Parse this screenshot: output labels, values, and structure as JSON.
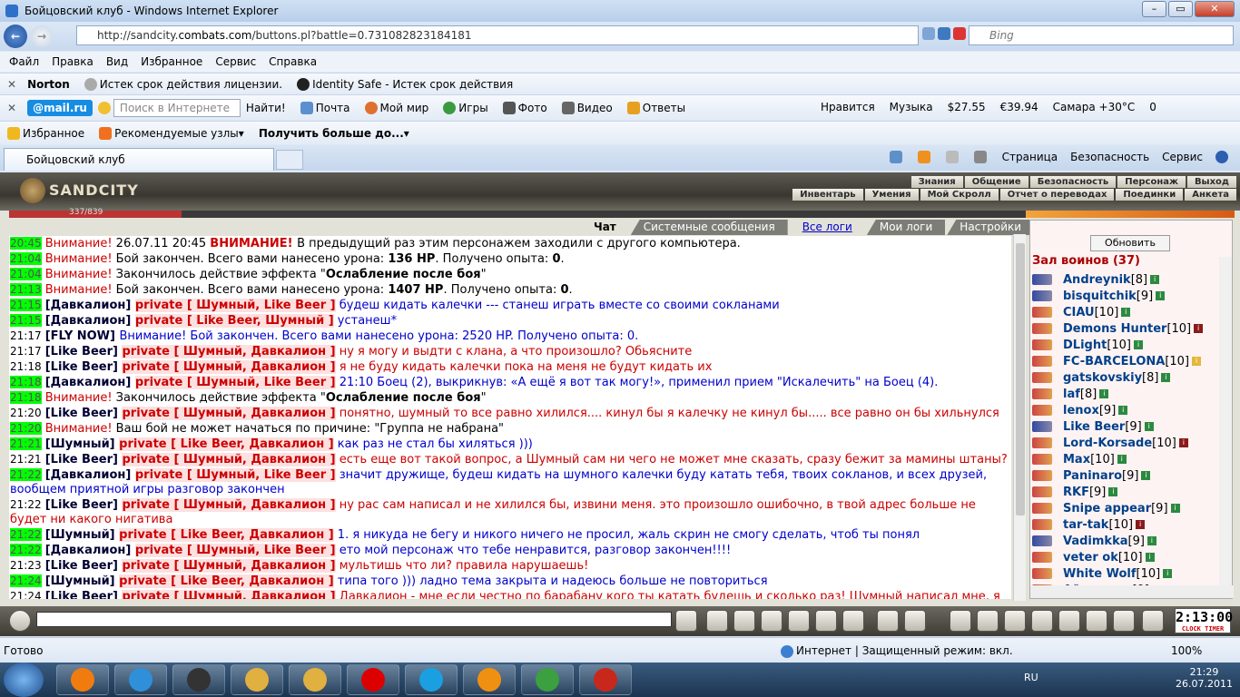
{
  "window": {
    "title": "Бойцовский клуб - Windows Internet Explorer",
    "url_prefix": "http://sandcity.",
    "url_host": "combats.com",
    "url_rest": "/buttons.pl?battle=0.731082823184181",
    "search_placeholder": "Bing"
  },
  "menu": [
    "Файл",
    "Правка",
    "Вид",
    "Избранное",
    "Сервис",
    "Справка"
  ],
  "norton": {
    "logo": "Norton",
    "items": [
      "Истек срок действия лицензии.",
      "Identity Safe - Истек срок действия"
    ]
  },
  "mailru": {
    "logo": "@mail.ru",
    "search_placeholder": "Поиск в Интернете",
    "find": "Найти!",
    "links": [
      "Почта",
      "Мой мир",
      "Игры",
      "Фото",
      "Видео",
      "Ответы"
    ],
    "right": [
      "Нравится",
      "Музыка",
      "$27.55",
      "€39.94",
      "Самара +30°C",
      "0"
    ]
  },
  "favorites": {
    "label": "Избранное",
    "items": [
      "Рекомендуемые узлы",
      "Получить больше до..."
    ]
  },
  "tab": {
    "title": "Бойцовский клуб"
  },
  "commandbar": [
    "Страница",
    "Безопасность",
    "Сервис"
  ],
  "game": {
    "logo": "SANDCITY",
    "menu1": [
      "Знания",
      "Общение",
      "Безопасность",
      "Персонаж",
      "Выход"
    ],
    "menu2": [
      "Инвентарь",
      "Умения",
      "Мой Скролл",
      "Отчет о переводах",
      "Поединки",
      "Анкета"
    ],
    "hp_label": "337/839",
    "chat_tabs": [
      "Чат",
      "Системные сообщения",
      "Все логи",
      "Мои логи",
      "Настройки"
    ],
    "chat": [
      {
        "t": "20:45",
        "hl": true,
        "parts": [
          [
            "red",
            "Внимание! "
          ],
          [
            "",
            "26.07.11 20:45 "
          ],
          [
            "redb",
            "ВНИМАНИЕ! "
          ],
          [
            "",
            "В предыдущий раз этим персонажем заходили с другого компьютера."
          ]
        ]
      },
      {
        "t": "21:04",
        "hl": true,
        "parts": [
          [
            "red",
            "Внимание! "
          ],
          [
            "",
            "Бой закончен. Всего вами нанесено урона: "
          ],
          [
            "b",
            "136 HP"
          ],
          [
            "",
            ". Получено опыта: "
          ],
          [
            "b",
            "0"
          ],
          [
            "",
            "."
          ]
        ]
      },
      {
        "t": "21:04",
        "hl": true,
        "parts": [
          [
            "red",
            "Внимание! "
          ],
          [
            "",
            "Закончилось действие эффекта \""
          ],
          [
            "b",
            "Ослабление после боя"
          ],
          [
            "",
            "\""
          ]
        ]
      },
      {
        "t": "21:13",
        "hl": true,
        "parts": [
          [
            "red",
            "Внимание! "
          ],
          [
            "",
            "Бой закончен. Всего вами нанесено урона: "
          ],
          [
            "b",
            "1407 HP"
          ],
          [
            "",
            ". Получено опыта: "
          ],
          [
            "b",
            "0"
          ],
          [
            "",
            "."
          ]
        ]
      },
      {
        "t": "21:15",
        "hl": true,
        "parts": [
          [
            "nick",
            "[Давкалион] "
          ],
          [
            "privb",
            "private [ Шумный, Like Beer ]"
          ],
          [
            "blue",
            " будеш кидать калечки --- станеш играть вместе со своими сокланами"
          ]
        ]
      },
      {
        "t": "21:15",
        "hl": true,
        "parts": [
          [
            "nick",
            "[Давкалион] "
          ],
          [
            "privb",
            "private [ Like Beer, Шумный ]"
          ],
          [
            "blue",
            " устанеш*"
          ]
        ]
      },
      {
        "t": "21:17",
        "hl": false,
        "parts": [
          [
            "nick",
            "[FLY NOW] "
          ],
          [
            "blue",
            "Внимание! Бой закончен. Всего вами нанесено урона: 2520 HP. Получено опыта: 0."
          ]
        ]
      },
      {
        "t": "21:17",
        "hl": false,
        "parts": [
          [
            "nick",
            "[Like Beer] "
          ],
          [
            "privb",
            "private [ Шумный, Давкалион ]"
          ],
          [
            "red",
            " ну я могу и выдти с клана, а что произошло? Обьясните"
          ]
        ]
      },
      {
        "t": "21:18",
        "hl": false,
        "parts": [
          [
            "nick",
            "[Like Beer] "
          ],
          [
            "privb",
            "private [ Шумный, Давкалион ]"
          ],
          [
            "red",
            " я не буду кидать калечки пока на меня не будут кидать их"
          ]
        ]
      },
      {
        "t": "21:18",
        "hl": true,
        "parts": [
          [
            "nick",
            "[Давкалион] "
          ],
          [
            "privb",
            "private [ Шумный, Like Beer ]"
          ],
          [
            "blue",
            " 21:10 Боец (2), выкрикнув: «А ещё я вот так могу!», применил прием \"Искалечить\" на Боец (4)."
          ]
        ]
      },
      {
        "t": "21:18",
        "hl": true,
        "parts": [
          [
            "red",
            "Внимание! "
          ],
          [
            "",
            "Закончилось действие эффекта \""
          ],
          [
            "b",
            "Ослабление после боя"
          ],
          [
            "",
            "\""
          ]
        ]
      },
      {
        "t": "21:20",
        "hl": false,
        "parts": [
          [
            "nick",
            "[Like Beer] "
          ],
          [
            "privb",
            "private [ Шумный, Давкалион ]"
          ],
          [
            "red",
            " понятно, шумный то все равно хилился.... кинул бы я калечку не кинул бы..... все равно он бы хильнулся"
          ]
        ]
      },
      {
        "t": "21:20",
        "hl": true,
        "parts": [
          [
            "red",
            "Внимание! "
          ],
          [
            "",
            "Ваш бой не может начаться по причине: \"Группа не набрана\""
          ]
        ]
      },
      {
        "t": "21:21",
        "hl": true,
        "parts": [
          [
            "nick",
            "[Шумный] "
          ],
          [
            "privb",
            "private [ Like Beer, Давкалион ]"
          ],
          [
            "blue",
            " как раз не стал бы хиляться )))"
          ]
        ]
      },
      {
        "t": "21:21",
        "hl": false,
        "parts": [
          [
            "nick",
            "[Like Beer] "
          ],
          [
            "privb",
            "private [ Шумный, Давкалион ]"
          ],
          [
            "red",
            " есть еще вот такой вопрос, а Шумный сам ни чего не может мне сказать, сразу бежит за мамины штаны?"
          ]
        ]
      },
      {
        "t": "21:22",
        "hl": true,
        "parts": [
          [
            "nick",
            "[Давкалион] "
          ],
          [
            "privb",
            "private [ Шумный, Like Beer ]"
          ],
          [
            "blue",
            " значит дружище, будеш кидать на шумного калечки буду катать тебя, твоих сокланов, и всех друзей, вообщем приятной игры разговор закончен"
          ]
        ]
      },
      {
        "t": "21:22",
        "hl": false,
        "parts": [
          [
            "nick",
            "[Like Beer] "
          ],
          [
            "privb",
            "private [ Шумный, Давкалион ]"
          ],
          [
            "red",
            " ну рас сам написал и не хилился бы, извини меня. это произошло ошибочно, в твой адрес больше не будет ни какого нигатива"
          ]
        ]
      },
      {
        "t": "21:22",
        "hl": true,
        "parts": [
          [
            "nick",
            "[Шумный] "
          ],
          [
            "privb",
            "private [ Like Beer, Давкалион ]"
          ],
          [
            "blue",
            " 1. я никуда не бегу и никого ничего не просил, жаль скрин не смогу сделать, чтоб ты понял"
          ]
        ]
      },
      {
        "t": "21:22",
        "hl": true,
        "parts": [
          [
            "nick",
            "[Давкалион] "
          ],
          [
            "privb",
            "private [ Шумный, Like Beer ]"
          ],
          [
            "blue",
            " ето мой персонаж что тебе ненравится, разговор закончен!!!!"
          ]
        ]
      },
      {
        "t": "21:23",
        "hl": false,
        "parts": [
          [
            "nick",
            "[Like Beer] "
          ],
          [
            "privb",
            "private [ Шумный, Давкалион ]"
          ],
          [
            "red",
            " мультишь что ли? правила нарушаешь!"
          ]
        ]
      },
      {
        "t": "21:24",
        "hl": true,
        "parts": [
          [
            "nick",
            "[Шумный] "
          ],
          [
            "privb",
            "private [ Like Beer, Давкалион ]"
          ],
          [
            "blue",
            " типа того ))) ладно тема закрыта и надеюсь больше не повториться"
          ]
        ]
      },
      {
        "t": "21:24",
        "hl": false,
        "parts": [
          [
            "nick",
            "[Like Beer] "
          ],
          [
            "privb",
            "private [ Шумный, Давкалион ]"
          ],
          [
            "red",
            " Давкалион - мне если честно по барабану кого ты катать будешь и сколько раз! Шумный написал мне, я извинился! Так что сам решай, я человек адекватный, просто пару боев на меня му да ки кидали какие то калечки,"
          ]
        ]
      }
    ],
    "hall": {
      "refresh": "Обновить",
      "title": "Зал воинов (37)",
      "players": [
        {
          "name": "Andreynik",
          "lvl": "[8]",
          "side": "blue",
          "inf": "g"
        },
        {
          "name": "bisquitchik",
          "lvl": "[9]",
          "side": "blue",
          "inf": "g"
        },
        {
          "name": "CIAU",
          "lvl": "[10]",
          "side": "red",
          "inf": "g"
        },
        {
          "name": "Demons Hunter",
          "lvl": "[10]",
          "side": "red",
          "inf": "r"
        },
        {
          "name": "DLight",
          "lvl": "[10]",
          "side": "red",
          "inf": "g"
        },
        {
          "name": "FC-BARCELONA",
          "lvl": "[10]",
          "side": "red",
          "inf": "y"
        },
        {
          "name": "gatskovskiy",
          "lvl": "[8]",
          "side": "red",
          "inf": "g"
        },
        {
          "name": "laf",
          "lvl": "[8]",
          "side": "red",
          "inf": "g"
        },
        {
          "name": "lenox",
          "lvl": "[9]",
          "side": "red",
          "inf": "g"
        },
        {
          "name": "Like Beer",
          "lvl": "[9]",
          "side": "blue",
          "inf": "g"
        },
        {
          "name": "Lord-Korsade",
          "lvl": "[10]",
          "side": "red",
          "inf": "r"
        },
        {
          "name": "Max",
          "lvl": "[10]",
          "side": "red",
          "inf": "g"
        },
        {
          "name": "Paninaro",
          "lvl": "[9]",
          "side": "red",
          "inf": "g"
        },
        {
          "name": "RKF",
          "lvl": "[9]",
          "side": "red",
          "inf": "g"
        },
        {
          "name": "Snipe appear",
          "lvl": "[9]",
          "side": "red",
          "inf": "g"
        },
        {
          "name": "tar-tak",
          "lvl": "[10]",
          "side": "red",
          "inf": "r"
        },
        {
          "name": "Vadimkka",
          "lvl": "[9]",
          "side": "blue",
          "inf": "g"
        },
        {
          "name": "veter ok",
          "lvl": "[10]",
          "side": "red",
          "inf": "g"
        },
        {
          "name": "White Wolf",
          "lvl": "[10]",
          "side": "red",
          "inf": "g"
        },
        {
          "name": "Айтишник",
          "lvl": "[9]",
          "side": "red",
          "inf": "g"
        }
      ]
    },
    "clock": "2:13:00",
    "clock_label": "CLOCK TIMER"
  },
  "status": {
    "left": "Готово",
    "zone": "Интернет | Защищенный режим: вкл.",
    "zoom": "100%"
  },
  "taskbar": {
    "lang": "RU",
    "time": "21:29",
    "date": "26.07.2011",
    "apps": [
      "#f07c10",
      "#2f8fd8",
      "#333",
      "#e0b040",
      "#e0b040",
      "#d00",
      "#1aa0e0",
      "#f09010",
      "#3aa040",
      "#c8281c"
    ]
  }
}
